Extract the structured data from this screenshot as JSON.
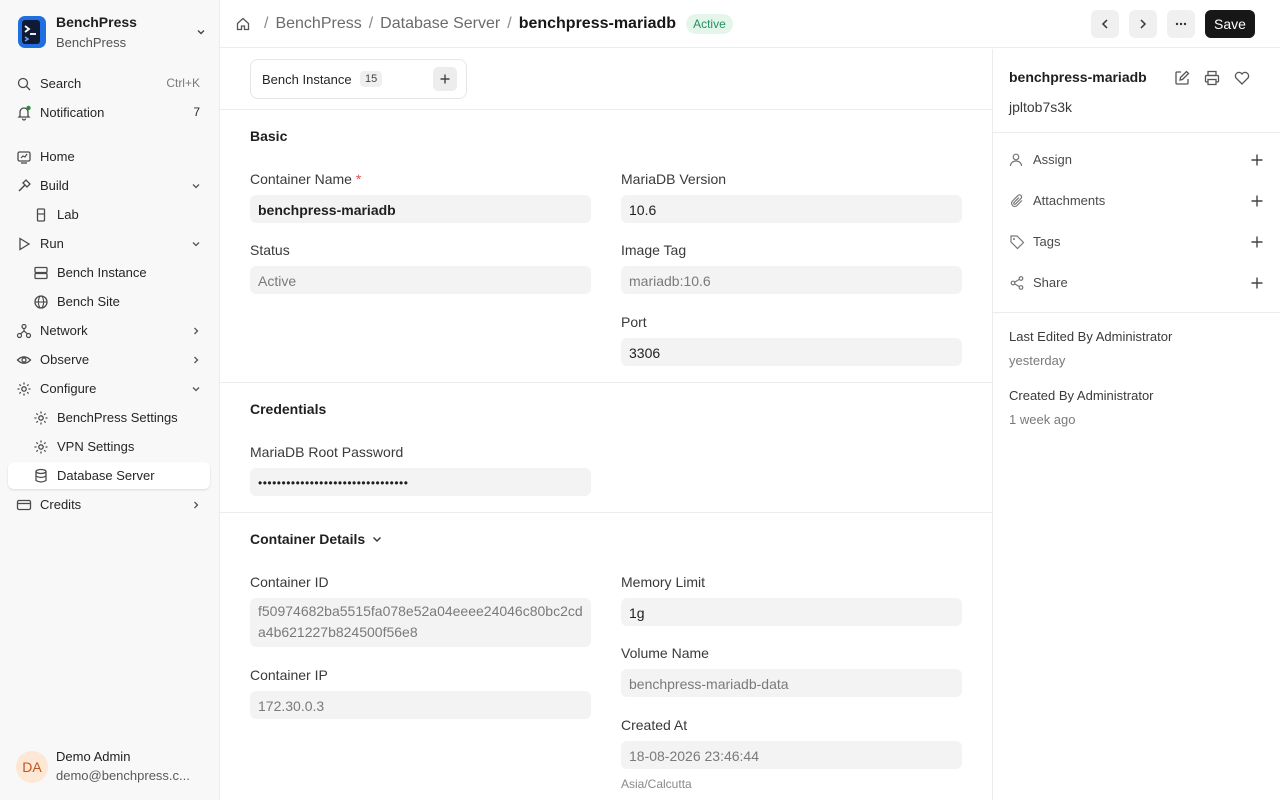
{
  "app": {
    "name": "BenchPress",
    "subtitle": "BenchPress"
  },
  "sidebar": {
    "search": {
      "label": "Search",
      "shortcut": "Ctrl+K"
    },
    "notification": {
      "label": "Notification",
      "count": "7"
    },
    "items": {
      "home": "Home",
      "build": "Build",
      "lab": "Lab",
      "run": "Run",
      "bench_instance": "Bench Instance",
      "bench_site": "Bench Site",
      "network": "Network",
      "observe": "Observe",
      "configure": "Configure",
      "benchpress_settings": "BenchPress Settings",
      "vpn_settings": "VPN Settings",
      "database_server": "Database Server",
      "credits": "Credits"
    },
    "user": {
      "initials": "DA",
      "name": "Demo Admin",
      "email": "demo@benchpress.c..."
    }
  },
  "header": {
    "breadcrumb": [
      "BenchPress",
      "Database Server",
      "benchpress-mariadb"
    ],
    "status": "Active",
    "save_label": "Save"
  },
  "connections": {
    "label": "Bench Instance",
    "count": "15"
  },
  "form": {
    "basic": {
      "title": "Basic",
      "container_name": {
        "label": "Container Name",
        "value": "benchpress-mariadb"
      },
      "status": {
        "label": "Status",
        "value": "Active"
      },
      "mariadb_version": {
        "label": "MariaDB Version",
        "value": "10.6"
      },
      "image_tag": {
        "label": "Image Tag",
        "value": "mariadb:10.6"
      },
      "port": {
        "label": "Port",
        "value": "3306"
      }
    },
    "credentials": {
      "title": "Credentials",
      "root_password": {
        "label": "MariaDB Root Password",
        "value": "••••••••••••••••••••••••••••••••"
      }
    },
    "container_details": {
      "title": "Container Details",
      "container_id": {
        "label": "Container ID",
        "value": "f50974682ba5515fa078e52a04eeee24046c80bc2cda4b621227b824500f56e8"
      },
      "container_ip": {
        "label": "Container IP",
        "value": "172.30.0.3"
      },
      "memory_limit": {
        "label": "Memory Limit",
        "value": "1g"
      },
      "volume_name": {
        "label": "Volume Name",
        "value": "benchpress-mariadb-data"
      },
      "created_at": {
        "label": "Created At",
        "value": "18-08-2026 23:46:44",
        "timezone": "Asia/Calcutta"
      }
    }
  },
  "right_panel": {
    "title": "benchpress-mariadb",
    "id": "jpltob7s3k",
    "actions": {
      "assign": "Assign",
      "attachments": "Attachments",
      "tags": "Tags",
      "share": "Share"
    },
    "last_edited": "Last Edited By Administrator",
    "last_edited_time": "yesterday",
    "created": "Created By Administrator",
    "created_time": "1 week ago"
  },
  "colors": {
    "accent_dark": "#171717",
    "status_green_bg": "#e4f5e9",
    "status_green_text": "#278f5e",
    "avatar_bg": "#fde7d5",
    "avatar_text": "#c2541f"
  }
}
